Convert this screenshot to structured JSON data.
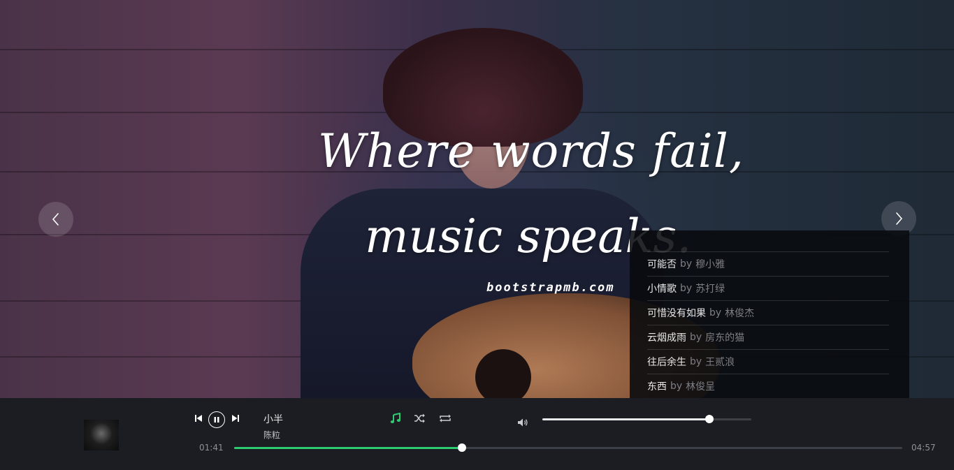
{
  "hero": {
    "slogan_line1": "Where words fail,",
    "slogan_line2": "music speaks.",
    "watermark": "bootstrapmb.com"
  },
  "playlist": {
    "by_word": "by",
    "songs": [
      {
        "title": "可能否",
        "artist": "穆小雅"
      },
      {
        "title": "小情歌",
        "artist": "苏打绿"
      },
      {
        "title": "可惜没有如果",
        "artist": "林俊杰"
      },
      {
        "title": "云烟成雨",
        "artist": "房东的猫"
      },
      {
        "title": "往后余生",
        "artist": "王贰浪"
      },
      {
        "title": "东西",
        "artist": "林俊呈"
      }
    ]
  },
  "player": {
    "track_title": "小半",
    "track_artist": "陈粒",
    "time_current": "01:41",
    "time_total": "04:57",
    "progress_fraction": 0.341,
    "volume_fraction": 0.8,
    "accent_color": "#2ecc71",
    "icons": [
      "previous-icon",
      "pause-icon",
      "next-icon",
      "music-note-icon",
      "shuffle-icon",
      "repeat-icon",
      "volume-icon"
    ]
  }
}
